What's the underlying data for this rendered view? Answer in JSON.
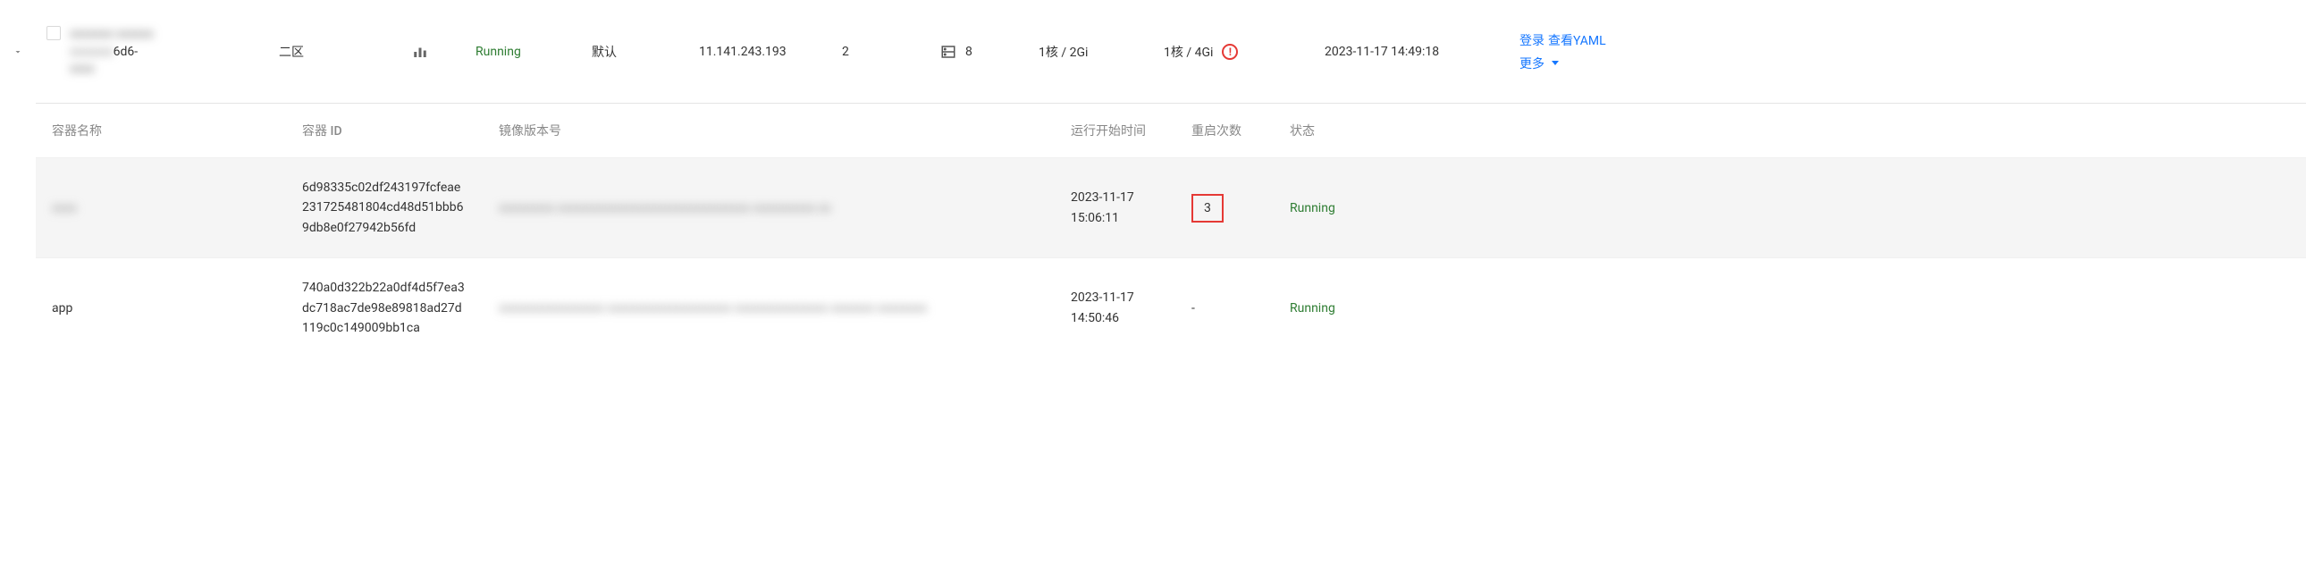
{
  "parent_row": {
    "name_obscured": "xxxxxxx xxxxxx",
    "name_suffix": "6d6-",
    "name_tail_obscured": "xxxx",
    "zone": "二区",
    "status": "Running",
    "schedule": "默认",
    "ip": "11.141.243.193",
    "count": "2",
    "disk_count": "8",
    "spec1": "1核 / 2Gi",
    "spec2": "1核 / 4Gi",
    "created": "2023-11-17 14:49:18"
  },
  "actions": {
    "login": "登录",
    "view_yaml": "查看YAML",
    "more": "更多"
  },
  "table": {
    "headers": {
      "name": "容器名称",
      "id": "容器 ID",
      "image": "镜像版本号",
      "start": "运行开始时间",
      "restart": "重启次数",
      "state": "状态"
    },
    "rows": [
      {
        "name": "xxxx",
        "name_is_blur": true,
        "id": "6d98335c02df243197fcfeae231725481804cd48d51bbb69db8e0f27942b56fd",
        "image_obscured": "xxxxxxxxx xxxxxxxxxxxxxxxxxxxxxxxxxxxxxxx xxxxxxxxxx xx",
        "start_date": "2023-11-17",
        "start_time": "15:06:11",
        "restart": "3",
        "restart_highlight": true,
        "state": "Running",
        "highlight": true
      },
      {
        "name": "app",
        "name_is_blur": false,
        "id": "740a0d322b22a0df4d5f7ea3dc718ac7de98e89818ad27d119c0c149009bb1ca",
        "image_obscured": "xxxxxxxxxxxxxxxxx xxxxxxxxxxxxxxxxxxxx xxxxxxxxxxxxxxx xxxxxxx xxxxxxxx",
        "start_date": "2023-11-17",
        "start_time": "14:50:46",
        "restart": "-",
        "restart_highlight": false,
        "state": "Running",
        "highlight": false
      }
    ]
  }
}
